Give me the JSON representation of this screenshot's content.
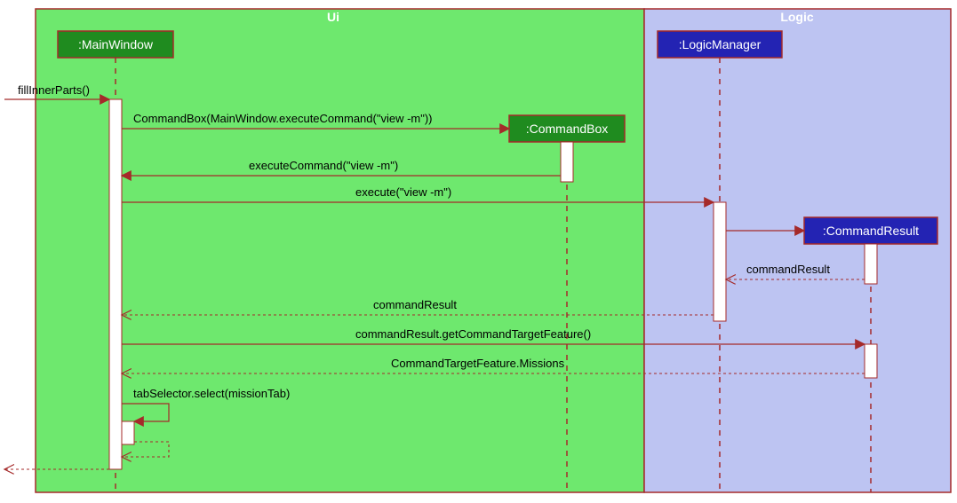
{
  "boxes": {
    "ui": "Ui",
    "logic": "Logic"
  },
  "lifelines": {
    "mainWindow": ":MainWindow",
    "commandBox": ":CommandBox",
    "logicManager": ":LogicManager",
    "commandResult": ":CommandResult"
  },
  "messages": {
    "fillInnerParts": "fillInnerParts()",
    "ctorCommandBox": "CommandBox(MainWindow.executeCommand(\"view -m\"))",
    "executeCommand": "executeCommand(\"view -m\")",
    "execute": "execute(\"view -m\")",
    "commandResult": "commandResult",
    "commandResult2": "commandResult",
    "getTarget": "commandResult.getCommandTargetFeature()",
    "targetReturn": "CommandTargetFeature.Missions",
    "selfCall": "tabSelector.select(missionTab)"
  }
}
